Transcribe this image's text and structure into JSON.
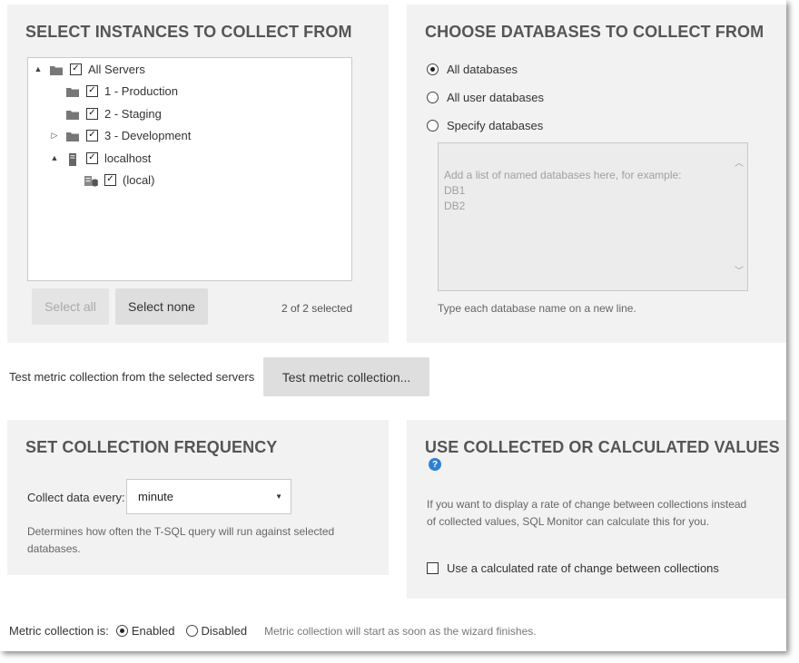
{
  "instances": {
    "title": "SELECT INSTANCES TO COLLECT FROM",
    "tree": [
      {
        "label": "All Servers",
        "expander": "▲",
        "icon": "folder-icon",
        "checked": true
      },
      {
        "label": "1 - Production",
        "expander": "",
        "icon": "folder-icon",
        "checked": true
      },
      {
        "label": "2 - Staging",
        "expander": "",
        "icon": "folder-icon",
        "checked": true
      },
      {
        "label": "3 - Development",
        "expander": "▷",
        "icon": "folder-icon",
        "checked": true
      },
      {
        "label": "localhost",
        "expander": "▲",
        "icon": "server-icon",
        "checked": true
      },
      {
        "label": "(local)",
        "expander": "",
        "icon": "sql-instance-icon",
        "checked": true
      }
    ],
    "select_all_label": "Select all",
    "select_none_label": "Select none",
    "selected_count": "2 of 2 selected"
  },
  "databases": {
    "title": "CHOOSE DATABASES TO COLLECT FROM",
    "options": [
      {
        "label": "All databases",
        "selected": true
      },
      {
        "label": "All user databases",
        "selected": false
      },
      {
        "label": "Specify databases",
        "selected": false
      }
    ],
    "placeholder": "Add a list of named databases here, for example:\nDB1\nDB2",
    "hint": "Type each database name on a new line."
  },
  "test": {
    "label": "Test metric collection from the selected servers",
    "button_label": "Test metric collection..."
  },
  "frequency": {
    "title": "SET COLLECTION FREQUENCY",
    "label": "Collect data every:",
    "value": "minute",
    "hint": "Determines how often the T-SQL query will run against selected databases."
  },
  "values": {
    "title": "USE COLLECTED OR CALCULATED VALUES",
    "help_icon": "help-icon",
    "description": "If you want to display a rate of change between collections instead of collected values, SQL Monitor can calculate this for you.",
    "checkbox_label": "Use a calculated rate of change between collections",
    "checkbox_checked": false
  },
  "status": {
    "label": "Metric collection is:",
    "enabled_label": "Enabled",
    "disabled_label": "Disabled",
    "enabled_selected": true,
    "note": "Metric collection will start as soon as the wizard finishes."
  },
  "colors": {
    "panel_bg": "#f2f2f2",
    "button_bg": "#e0e0e0",
    "help_icon": "#2f7fd6"
  }
}
